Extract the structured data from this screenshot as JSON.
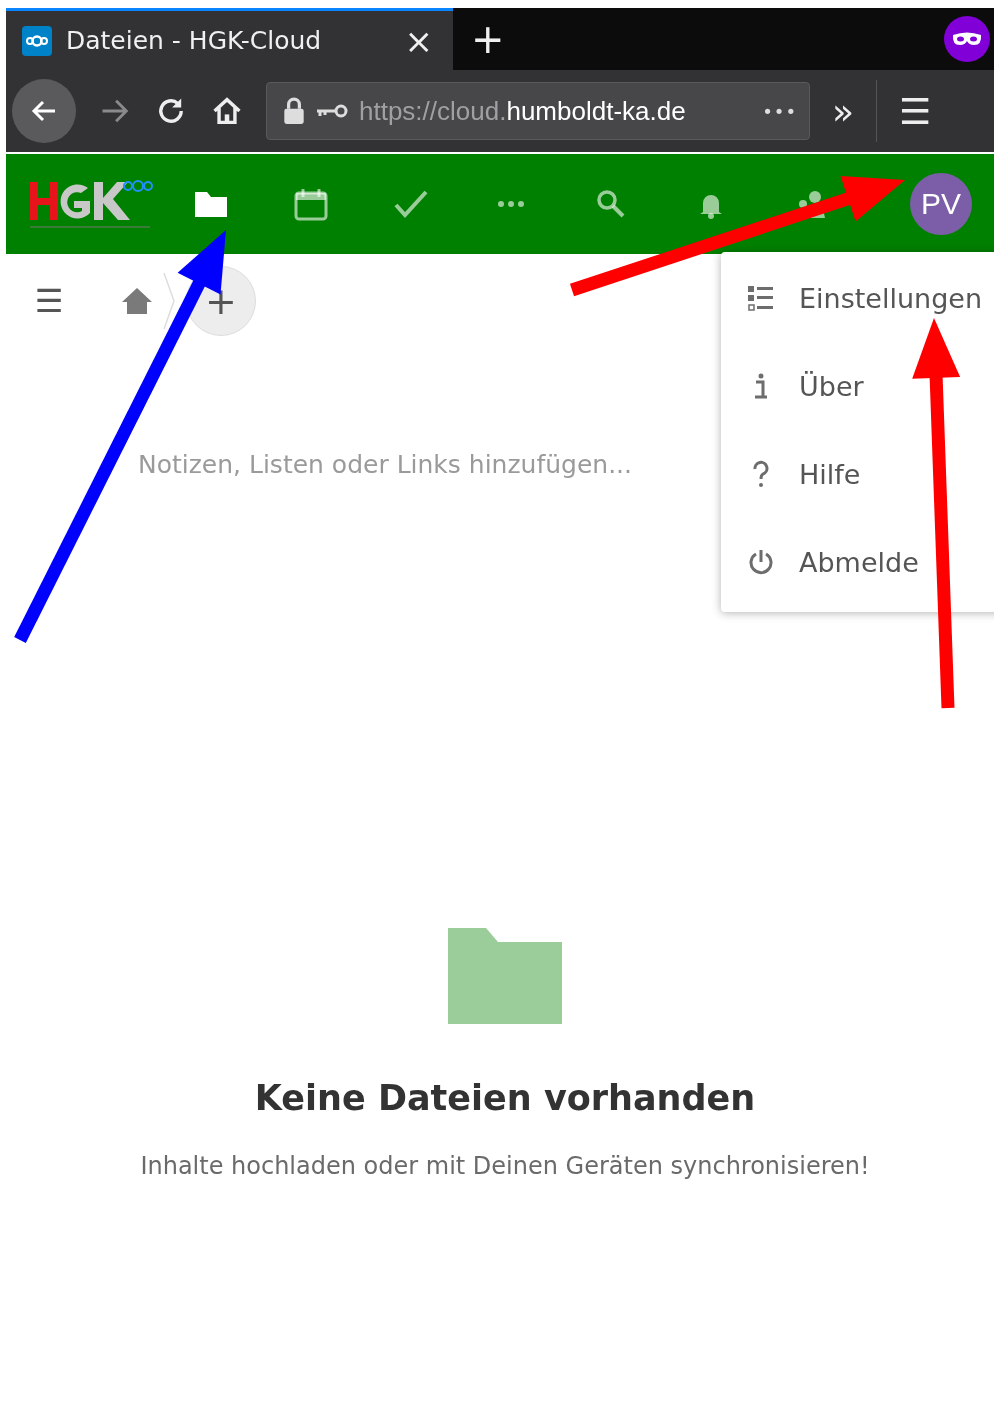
{
  "browser": {
    "tab": {
      "title": "Dateien - HGK-Cloud",
      "close": "×",
      "selected": true
    },
    "new_tab": "+",
    "url": {
      "scheme": "https://cloud.",
      "host": "humboldt-ka.de",
      "more": "•••"
    },
    "overflow": "»",
    "menu": "☰"
  },
  "header": {
    "apps": [
      {
        "kind": "files",
        "selected": true
      },
      {
        "kind": "calendar",
        "selected": false
      },
      {
        "kind": "tasks",
        "selected": false
      },
      {
        "kind": "more",
        "selected": false
      },
      {
        "kind": "search",
        "selected": false
      },
      {
        "kind": "notifications",
        "selected": false
      },
      {
        "kind": "contacts",
        "selected": false
      }
    ],
    "avatar": "PV"
  },
  "user_menu": [
    {
      "kind": "settings",
      "label": "Einstellungen"
    },
    {
      "kind": "about",
      "label": "Über"
    },
    {
      "kind": "help",
      "label": "Hilfe"
    },
    {
      "kind": "logout",
      "label": "Abmelde"
    }
  ],
  "breadcrumb": {
    "menu": "☰",
    "add": "+"
  },
  "notes": {
    "placeholder": "Notizen, Listen oder Links hinzufügen..."
  },
  "empty": {
    "title": "Keine Dateien vorhanden",
    "text": "Inhalte hochladen oder mit Deinen Geräten synchronisieren!"
  },
  "annotations": [
    {
      "color": "#0000ff"
    },
    {
      "color": "#ff0000"
    },
    {
      "color": "#ff0000"
    }
  ]
}
